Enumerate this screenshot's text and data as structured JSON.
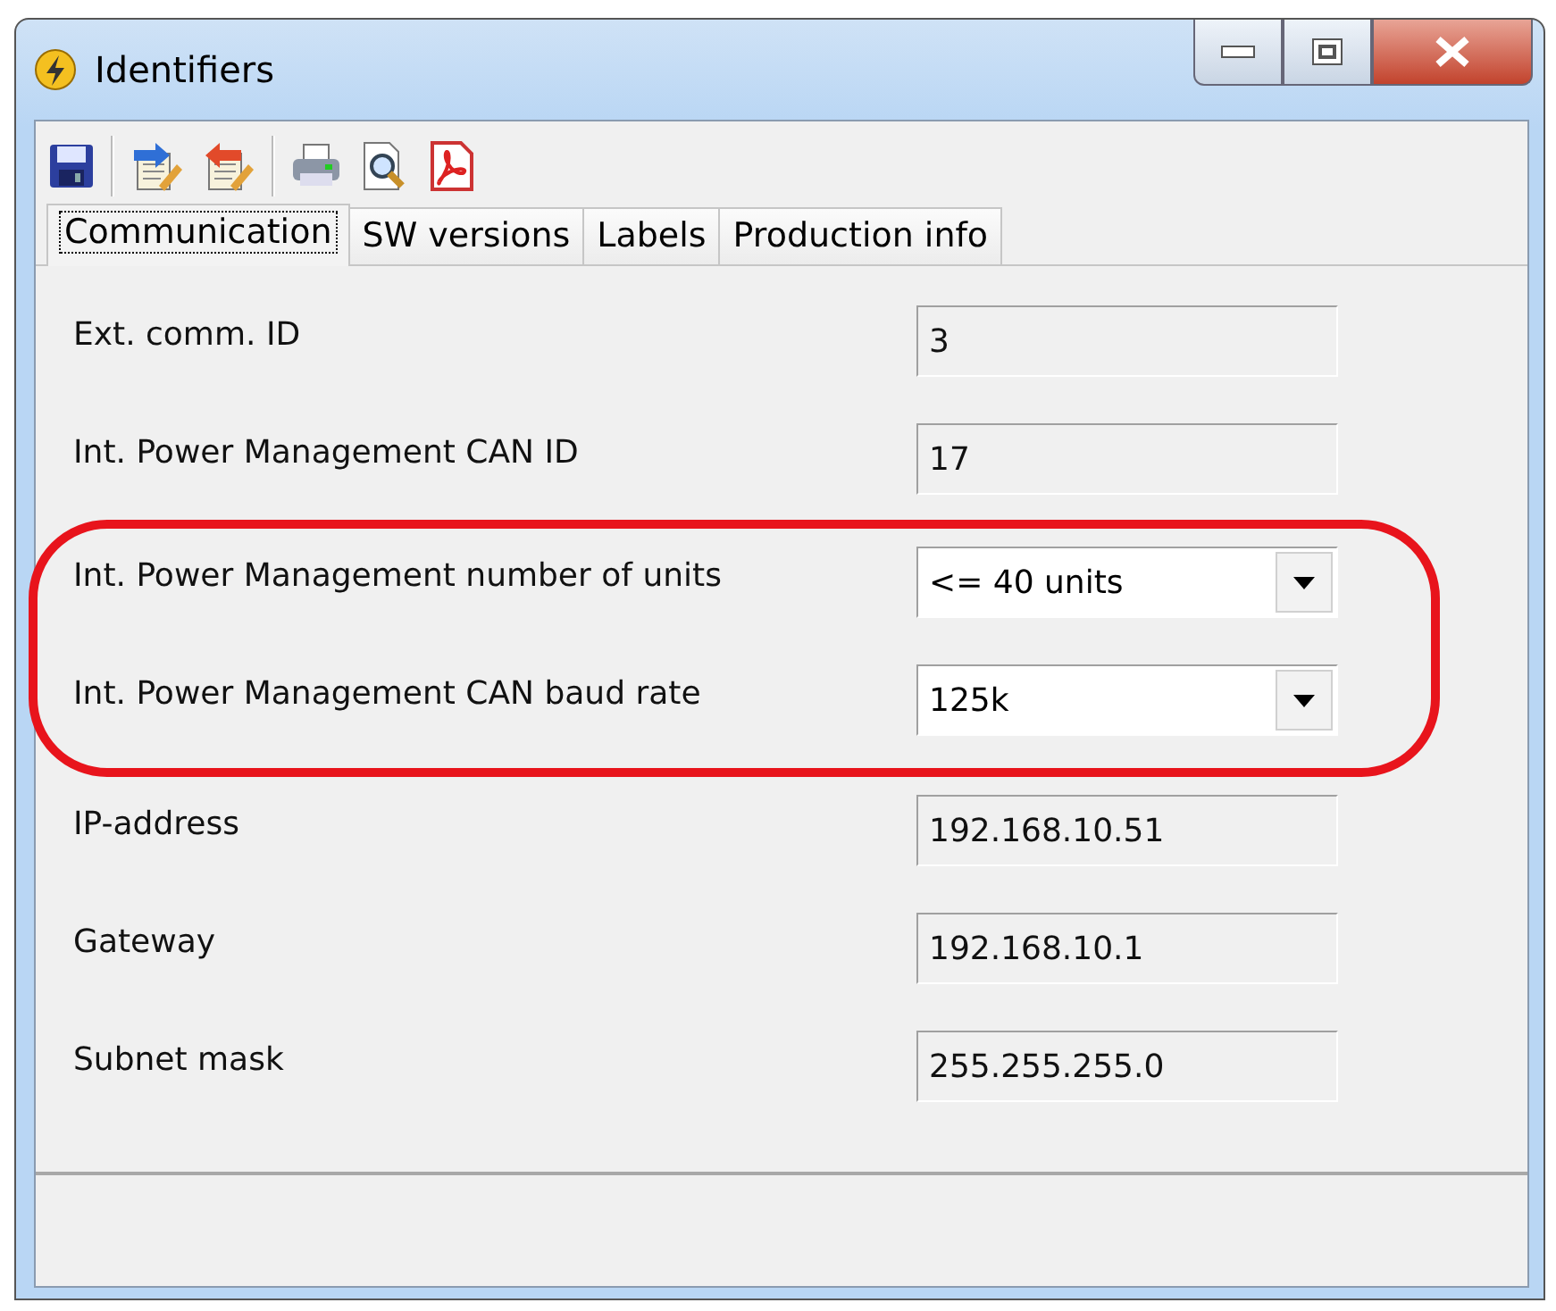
{
  "window": {
    "title": "Identifiers"
  },
  "toolbar": [
    {
      "kind": "save"
    },
    {
      "kind": "separator"
    },
    {
      "kind": "import"
    },
    {
      "kind": "export"
    },
    {
      "kind": "separator"
    },
    {
      "kind": "print"
    },
    {
      "kind": "preview"
    },
    {
      "kind": "pdf"
    }
  ],
  "tabs": [
    {
      "label": "Communication",
      "selected": true
    },
    {
      "label": "SW versions",
      "selected": false
    },
    {
      "label": "Labels",
      "selected": false
    },
    {
      "label": "Production info",
      "selected": false
    }
  ],
  "fields": [
    {
      "label": "Ext. comm. ID",
      "kind": "text",
      "value": "3",
      "highlighted": false
    },
    {
      "label": "Int. Power Management CAN ID",
      "kind": "text",
      "value": "17",
      "highlighted": false
    },
    {
      "label": "Int. Power Management number of units",
      "kind": "dropdown",
      "value": "<= 40 units",
      "highlighted": true
    },
    {
      "label": "Int. Power Management CAN baud rate",
      "kind": "dropdown",
      "value": "125k",
      "highlighted": true
    },
    {
      "label": "IP-address",
      "kind": "text",
      "value": "192.168.10.51",
      "highlighted": false
    },
    {
      "label": "Gateway",
      "kind": "text",
      "value": "192.168.10.1",
      "highlighted": false
    },
    {
      "label": "Subnet mask",
      "kind": "text",
      "value": "255.255.255.0",
      "highlighted": false
    }
  ]
}
